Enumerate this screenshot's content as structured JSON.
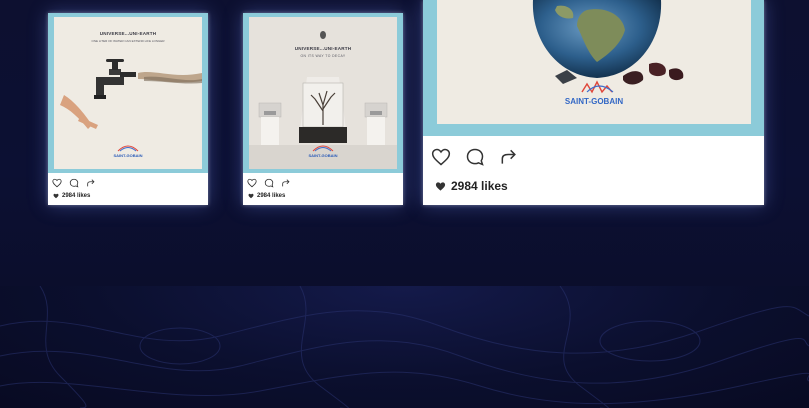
{
  "posts": [
    {
      "poster_title": "UNIVERSE...UNI-EARTH",
      "poster_subtitle": "ONE LITER OF WATER CAN EXTEND LIFE LONGER",
      "brand": "SAINT-GOBAIN",
      "likes": "2984 likes"
    },
    {
      "poster_title": "UNIVERSE...UNI-EARTH",
      "poster_subtitle": "ON ITS WAY TO DECAY",
      "brand": "SAINT-GOBAIN",
      "likes": "2984 likes"
    },
    {
      "brand": "SAINT-GOBAIN",
      "likes": "2984 likes"
    }
  ],
  "colors": {
    "background": "#0c1033",
    "frame": "#8ccbd9",
    "poster": "#efebe3",
    "brand": "#2a5bb8"
  },
  "icons": [
    "heart-icon",
    "comment-icon",
    "share-icon"
  ]
}
